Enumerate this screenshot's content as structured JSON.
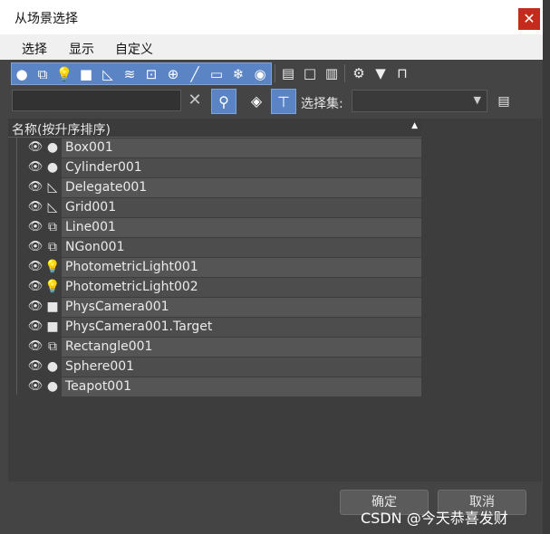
{
  "window": {
    "title": "从场景选择",
    "close_glyph": "✕"
  },
  "menu": [
    "选择",
    "显示",
    "自定义"
  ],
  "filter_icons": [
    {
      "name": "geometry-filter-icon",
      "glyph": "●"
    },
    {
      "name": "shapes-filter-icon",
      "glyph": "⧉"
    },
    {
      "name": "lights-filter-icon",
      "glyph": "💡"
    },
    {
      "name": "cameras-filter-icon",
      "glyph": "■"
    },
    {
      "name": "helpers-filter-icon",
      "glyph": "◺"
    },
    {
      "name": "spacewarps-filter-icon",
      "glyph": "≋"
    },
    {
      "name": "groups-filter-icon",
      "glyph": "⊡"
    },
    {
      "name": "xrefs-filter-icon",
      "glyph": "⊕"
    },
    {
      "name": "bones-filter-icon",
      "glyph": "╱"
    },
    {
      "name": "containers-filter-icon",
      "glyph": "▭"
    },
    {
      "name": "frozen-filter-icon",
      "glyph": "❄"
    },
    {
      "name": "hidden-filter-icon",
      "glyph": "◉"
    }
  ],
  "tool_icons": [
    {
      "name": "select-all-icon",
      "glyph": "▤"
    },
    {
      "name": "select-none-icon",
      "glyph": "□"
    },
    {
      "name": "invert-selection-icon",
      "glyph": "▥"
    },
    {
      "name": "filter-settings-icon",
      "glyph": "⚙"
    },
    {
      "name": "filter-icon",
      "glyph": "▼"
    },
    {
      "name": "display-children-icon",
      "glyph": "⊓"
    }
  ],
  "search": {
    "value": "",
    "placeholder": ""
  },
  "clear_glyph": "✕",
  "search_toggle_glyph": "⚲",
  "layers_glyph": "◈",
  "hierarchy_glyph": "⊤",
  "selection_set": {
    "label": "选择集:",
    "value": "",
    "arrow": "▼"
  },
  "selection_set_button_glyph": "▤",
  "column": {
    "header": "名称(按升序排序)",
    "sort_glyph": "▲"
  },
  "objects": [
    {
      "name": "Box001",
      "eye": "👁",
      "type_icon": "●",
      "type_name": "geometry-type-icon"
    },
    {
      "name": "Cylinder001",
      "eye": "👁",
      "type_icon": "●",
      "type_name": "geometry-type-icon"
    },
    {
      "name": "Delegate001",
      "eye": "👁",
      "type_icon": "◺",
      "type_name": "helper-type-icon"
    },
    {
      "name": "Grid001",
      "eye": "👁",
      "type_icon": "◺",
      "type_name": "helper-type-icon"
    },
    {
      "name": "Line001",
      "eye": "👁",
      "type_icon": "⧉",
      "type_name": "shape-type-icon"
    },
    {
      "name": "NGon001",
      "eye": "👁",
      "type_icon": "⧉",
      "type_name": "shape-type-icon"
    },
    {
      "name": "PhotometricLight001",
      "eye": "👁",
      "type_icon": "💡",
      "type_name": "light-type-icon"
    },
    {
      "name": "PhotometricLight002",
      "eye": "👁",
      "type_icon": "💡",
      "type_name": "light-type-icon"
    },
    {
      "name": "PhysCamera001",
      "eye": "👁",
      "type_icon": "■",
      "type_name": "camera-type-icon"
    },
    {
      "name": "PhysCamera001.Target",
      "eye": "👁",
      "type_icon": "■",
      "type_name": "camera-type-icon"
    },
    {
      "name": "Rectangle001",
      "eye": "👁",
      "type_icon": "⧉",
      "type_name": "shape-type-icon"
    },
    {
      "name": "Sphere001",
      "eye": "👁",
      "type_icon": "●",
      "type_name": "geometry-type-icon"
    },
    {
      "name": "Teapot001",
      "eye": "👁",
      "type_icon": "●",
      "type_name": "geometry-type-icon"
    }
  ],
  "buttons": {
    "ok": "确定",
    "cancel": "取消"
  },
  "watermark": "CSDN @今天恭喜发财",
  "colors": {
    "accent": "#5a84c4",
    "close": "#c42b1c",
    "panel": "#444444"
  }
}
